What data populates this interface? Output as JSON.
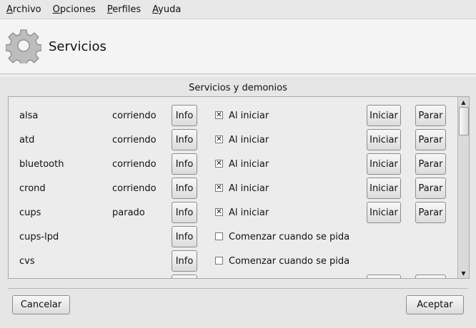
{
  "menu": [
    {
      "mnemonic": "A",
      "rest": "rchivo"
    },
    {
      "mnemonic": "O",
      "rest": "pciones"
    },
    {
      "mnemonic": "P",
      "rest": "erfiles"
    },
    {
      "mnemonic": "A",
      "rest": "yuda"
    }
  ],
  "header": {
    "title": "Servicios",
    "icon": "gear-icon"
  },
  "group_title": "Servicios y demonios",
  "labels": {
    "info": "Info",
    "start": "Iniciar",
    "stop": "Parar"
  },
  "services": [
    {
      "name": "alsa",
      "status": "corriendo",
      "checked": true,
      "check_label": "Al iniciar",
      "controls": true
    },
    {
      "name": "atd",
      "status": "corriendo",
      "checked": true,
      "check_label": "Al iniciar",
      "controls": true
    },
    {
      "name": "bluetooth",
      "status": "corriendo",
      "checked": true,
      "check_label": "Al iniciar",
      "controls": true
    },
    {
      "name": "crond",
      "status": "corriendo",
      "checked": true,
      "check_label": "Al iniciar",
      "controls": true
    },
    {
      "name": "cups",
      "status": "parado",
      "checked": true,
      "check_label": "Al iniciar",
      "controls": true
    },
    {
      "name": "cups-lpd",
      "status": "",
      "checked": false,
      "check_label": "Comenzar cuando se pida",
      "controls": false
    },
    {
      "name": "cvs",
      "status": "",
      "checked": false,
      "check_label": "Comenzar cuando se pida",
      "controls": false
    },
    {
      "name": "",
      "status": "",
      "checked": false,
      "check_label": "",
      "controls": true
    }
  ],
  "footer": {
    "cancel": "Cancelar",
    "accept": "Aceptar"
  }
}
